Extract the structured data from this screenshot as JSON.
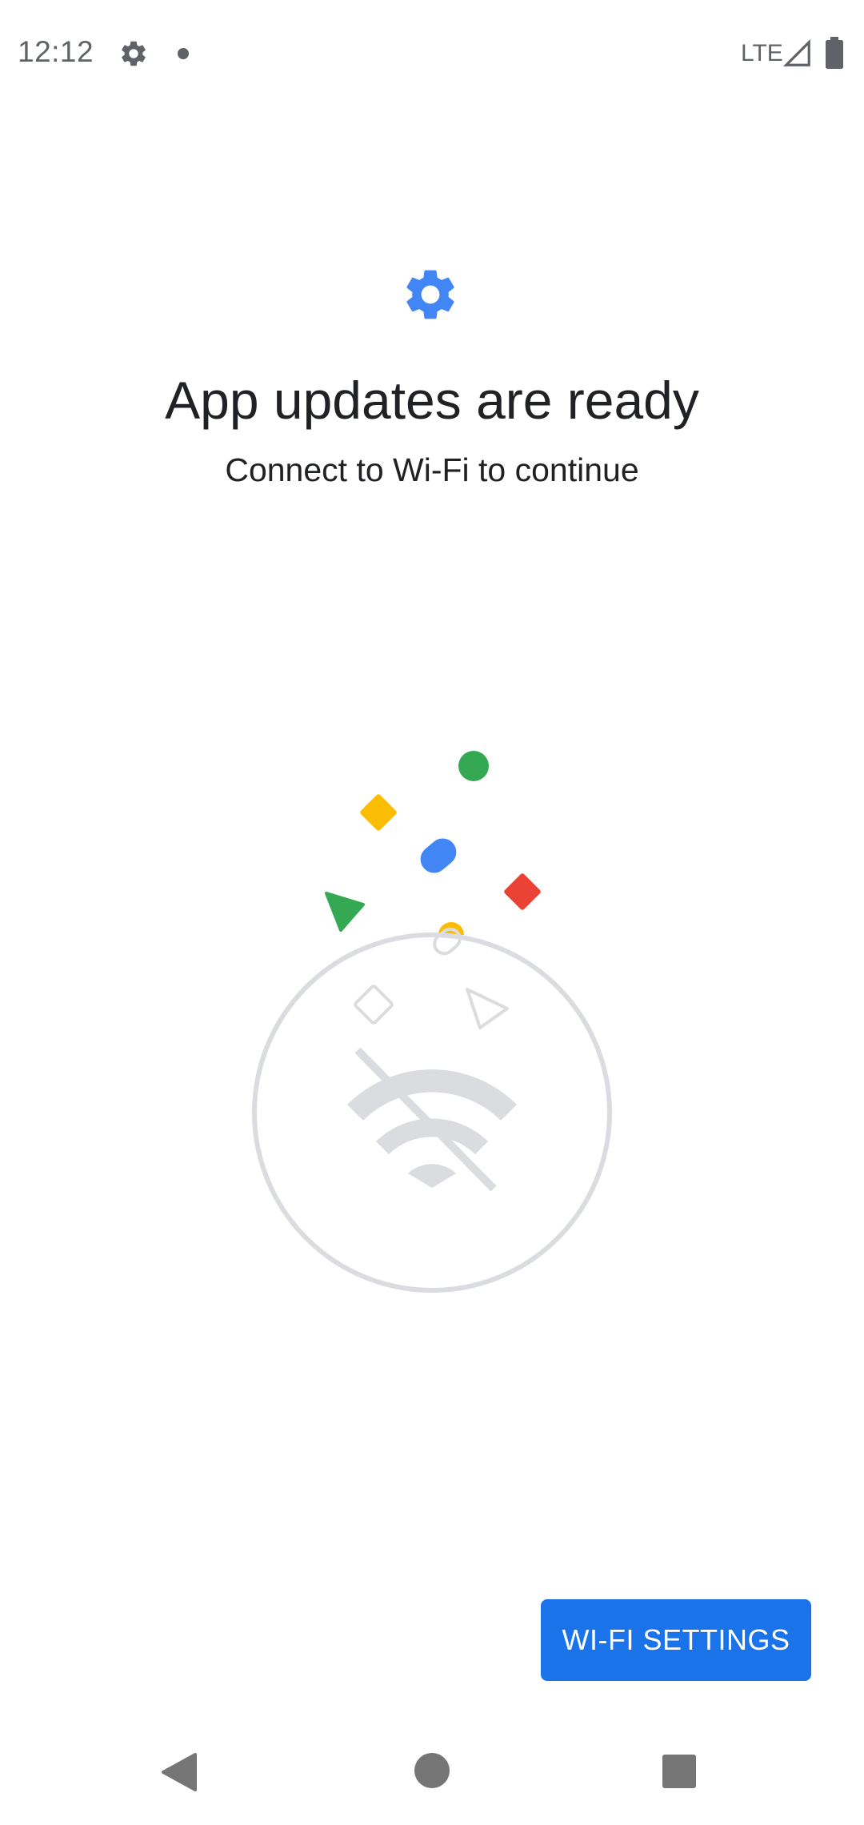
{
  "status_bar": {
    "time": "12:12",
    "network": "LTE",
    "icons": [
      "gear-icon",
      "notification-dot-icon",
      "signal-icon",
      "battery-icon"
    ]
  },
  "header": {
    "icon": "gear-icon",
    "title": "App updates are ready",
    "subtitle": "Connect to Wi-Fi to continue"
  },
  "illustration": {
    "icon": "wifi-off-icon"
  },
  "actions": {
    "wifi_settings_label": "WI-FI SETTINGS"
  },
  "nav_bar": {
    "items": [
      "back-icon",
      "home-icon",
      "recents-icon"
    ]
  },
  "colors": {
    "accent": "#1a73e8",
    "icon_blue": "#4285f4",
    "green": "#34a853",
    "yellow": "#fbbc04",
    "red": "#ea4335",
    "illustration_gray": "#dadce0",
    "text": "#202124"
  }
}
